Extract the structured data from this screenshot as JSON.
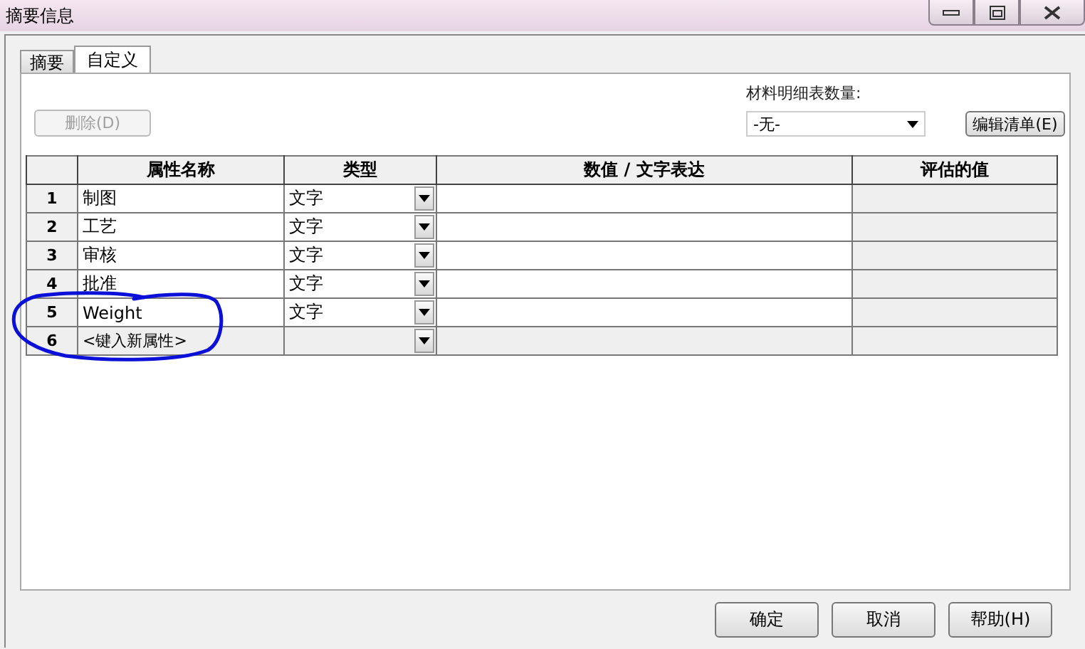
{
  "window": {
    "title": "摘要信息"
  },
  "tabs": [
    {
      "label": "摘要",
      "selected": false
    },
    {
      "label": "自定义",
      "selected": true
    }
  ],
  "delete_button": {
    "label": "删除(D)",
    "disabled": true
  },
  "bom_quantity": {
    "label": "材料明细表数量:",
    "value": "-无-"
  },
  "edit_list_button": {
    "label": "编辑清单(E)"
  },
  "table": {
    "columns": [
      "属性名称",
      "类型",
      "数值 / 文字表达",
      "评估的值"
    ],
    "rows": [
      {
        "number": "1",
        "name": "制图",
        "type": "文字",
        "kind": "property"
      },
      {
        "number": "2",
        "name": "工艺",
        "type": "文字",
        "kind": "property"
      },
      {
        "number": "3",
        "name": "审核",
        "type": "文字",
        "kind": "property"
      },
      {
        "number": "4",
        "name": "批准",
        "type": "文字",
        "kind": "property"
      },
      {
        "number": "5",
        "name": "Weight",
        "type": "文字",
        "kind": "property"
      },
      {
        "number": "6",
        "name": "<键入新属性>",
        "kind": "new"
      }
    ]
  },
  "buttons": [
    {
      "label": "确定"
    },
    {
      "label": "取消"
    },
    {
      "label": "帮助(H)"
    }
  ]
}
